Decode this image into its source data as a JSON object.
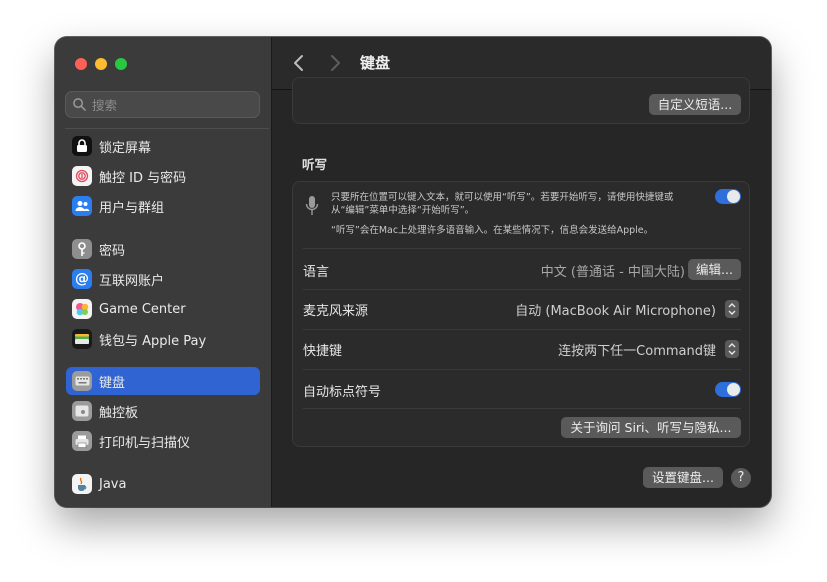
{
  "sidebar": {
    "search_placeholder": "搜索",
    "items": [
      {
        "label": "锁定屏幕"
      },
      {
        "label": "触控 ID 与密码"
      },
      {
        "label": "用户与群组"
      },
      {
        "label": "密码"
      },
      {
        "label": "互联网账户"
      },
      {
        "label": "Game Center"
      },
      {
        "label": "钱包与 Apple Pay"
      },
      {
        "label": "键盘"
      },
      {
        "label": "触控板"
      },
      {
        "label": "打印机与扫描仪"
      },
      {
        "label": "Java"
      }
    ],
    "active_item": "键盘"
  },
  "header": {
    "title": "键盘"
  },
  "top_section": {
    "text_replacement_button": "自定义短语..."
  },
  "dictation": {
    "section_title": "听写",
    "description_line1": "只要所在位置可以键入文本，就可以使用“听写”。若要开始听写，请使用快捷键或",
    "description_line2": "从“编辑”菜单中选择“开始听写”。",
    "privacy_note": "“听写”会在Mac上处理许多语音输入。在某些情况下，信息会发送给Apple。",
    "enabled": true,
    "language_label": "语言",
    "language_value": "中文 (普通话 - 中国大陆)",
    "language_edit_button": "编辑...",
    "mic_label": "麦克风来源",
    "mic_value": "自动 (MacBook Air Microphone)",
    "shortcut_label": "快捷键",
    "shortcut_value": "连按两下任一Command键",
    "auto_punct_label": "自动标点符号",
    "auto_punct_enabled": true,
    "privacy_button": "关于询问 Siri、听写与隐私..."
  },
  "footer": {
    "setup_keyboard_button": "设置键盘...",
    "help_label": "?"
  },
  "colors": {
    "accent": "#2f64d2",
    "toggle_on": "#2f6fd9",
    "window_bg": "#262626",
    "sidebar_bg": "#3c3b3b"
  }
}
